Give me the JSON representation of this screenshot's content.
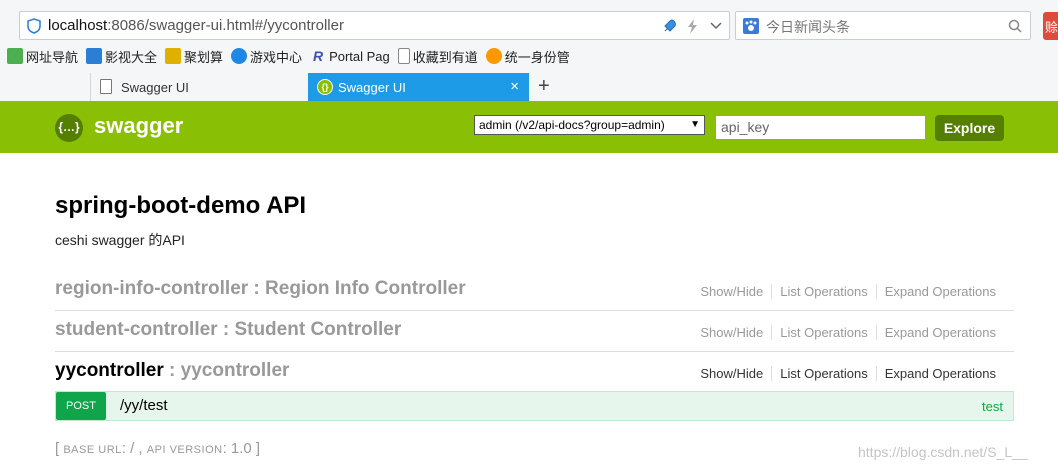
{
  "browser": {
    "url_host": "localhost",
    "url_rest": ":8086/swagger-ui.html#/yycontroller",
    "search_placeholder": "今日新闻头条",
    "corner_badge": "赊",
    "bookmarks": [
      {
        "label": "网址导航",
        "color": "#4caf50"
      },
      {
        "label": "影视大全",
        "color": "#2a7fd4"
      },
      {
        "label": "聚划算",
        "color": "#e0b000"
      },
      {
        "label": "游戏中心",
        "color": "#1e88e5"
      },
      {
        "label": "Portal Pag",
        "color": "#3f51b5"
      },
      {
        "label": "收藏到有道",
        "color": "#999999"
      },
      {
        "label": "统一身份管",
        "color": "#ff9800"
      }
    ],
    "tabs": [
      {
        "label": "Swagger UI",
        "active": false
      },
      {
        "label": "Swagger UI",
        "active": true
      }
    ],
    "tab_close": "×",
    "new_tab": "+"
  },
  "header": {
    "logo_glyph": "{…}",
    "logo_text": "swagger",
    "api_select": "admin (/v2/api-docs?group=admin)",
    "api_key_placeholder": "api_key",
    "explore_label": "Explore"
  },
  "info": {
    "title": "spring-boot-demo API",
    "description": "ceshi swagger 的API"
  },
  "resources": [
    {
      "name": "region-info-controller",
      "sep": " : ",
      "desc": "Region Info Controller",
      "active": false
    },
    {
      "name": "student-controller",
      "sep": " : ",
      "desc": "Student Controller",
      "active": false
    },
    {
      "name": "yycontroller",
      "sep": " : ",
      "desc": "yycontroller",
      "active": true
    }
  ],
  "resource_ops": {
    "show_hide": "Show/Hide",
    "list": "List Operations",
    "expand": "Expand Operations"
  },
  "endpoint": {
    "method": "POST",
    "path": "/yy/test",
    "summary": "test"
  },
  "footer": {
    "open": "[ ",
    "base_url_label": "BASE URL",
    "base_url_value": ": / , ",
    "api_version_label": "API VERSION",
    "api_version_value": ": 1.0 ]"
  },
  "watermark": "https://blog.csdn.net/S_L__",
  "colors": {
    "swagger_green": "#89bf04",
    "dark_green": "#547f00",
    "post_green": "#10a54a",
    "tab_active": "#1e9be6"
  }
}
